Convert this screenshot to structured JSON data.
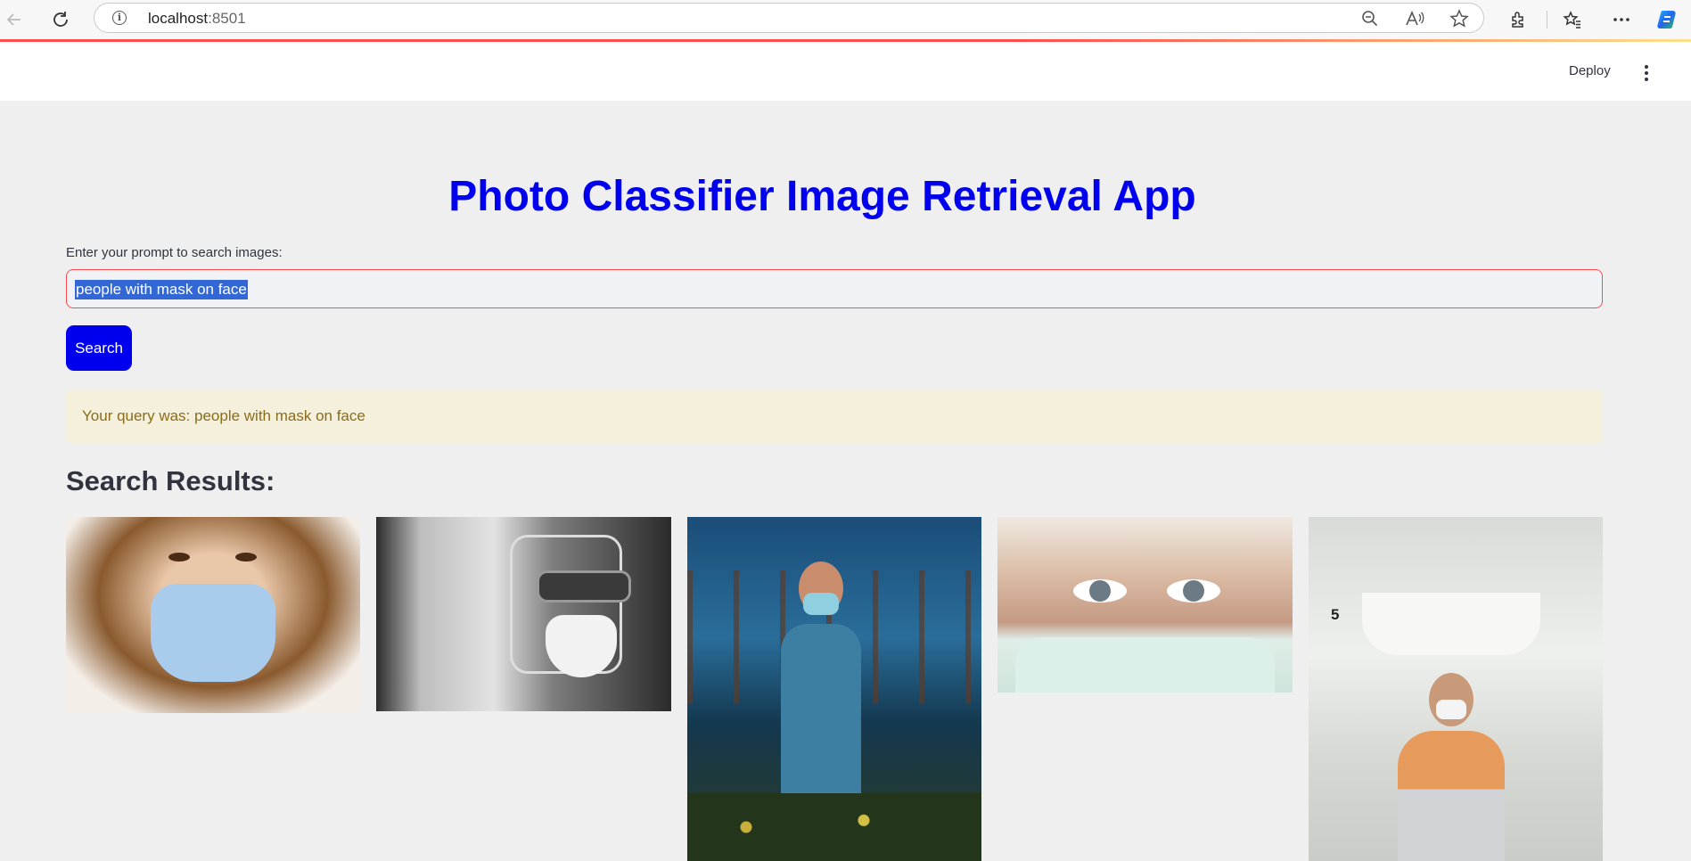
{
  "browser": {
    "address_host": "localhost",
    "address_port": ":8501"
  },
  "header": {
    "deploy_label": "Deploy"
  },
  "main": {
    "title": "Photo Classifier Image Retrieval App",
    "input_label": "Enter your prompt to search images:",
    "input_value": "people with mask on face",
    "search_label": "Search",
    "query_message": "Your query was: people with mask on face",
    "results_title": "Search Results:",
    "image5_label": "5"
  },
  "colors": {
    "title": "#0000ee",
    "search_button": "#0000ee",
    "input_border": "#ff4b4b",
    "alert_bg": "#f5f0dc",
    "alert_text": "#8a6d1a"
  },
  "icons": [
    "back-icon",
    "refresh-icon",
    "info-icon",
    "zoom-out-icon",
    "read-aloud-icon",
    "favorite-star-icon",
    "extensions-icon",
    "favorites-icon",
    "more-icon",
    "copilot-icon",
    "kebab-menu-icon"
  ]
}
